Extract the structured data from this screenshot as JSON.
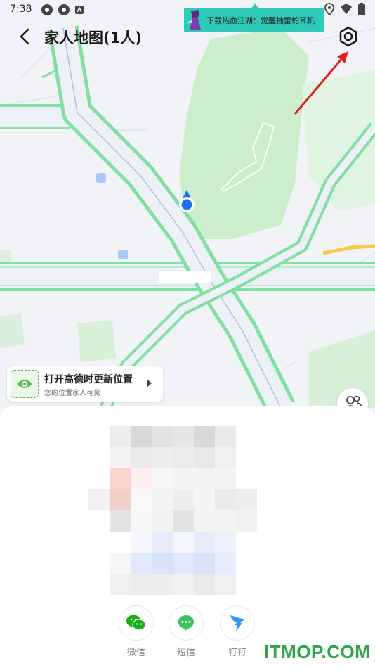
{
  "status_bar": {
    "time": "7:38",
    "left_icons": [
      "settings-icon",
      "settings-icon",
      "app-icon"
    ],
    "right_icons": [
      "location-icon",
      "wifi-icon",
      "battery-icon"
    ]
  },
  "ad_banner": {
    "text": "下载热血江湖：觉醒抽雷蛇耳机"
  },
  "topbar": {
    "title": "家人地图(1人)",
    "back_icon": "chevron-left-icon",
    "settings_icon": "hexagon-settings-icon"
  },
  "location_card": {
    "title": "打开高德时更新位置",
    "subtitle": "您的位置家人可见",
    "icon": "eye-icon"
  },
  "share": {
    "items": [
      {
        "label": "微信",
        "icon": "wechat-icon",
        "color": "#1aad19"
      },
      {
        "label": "短信",
        "icon": "message-icon",
        "color": "#3cc35b"
      },
      {
        "label": "钉钉",
        "icon": "dingtalk-icon",
        "color": "#3296fa"
      }
    ]
  },
  "watermark": {
    "text": "ITMOP.COM"
  },
  "colors": {
    "road_green": "#7fe0a0",
    "park_green": "#cdeecd",
    "map_bg": "#f1f3f7",
    "annotation_arrow": "#e02020",
    "location_dot": "#1e6ff0"
  }
}
